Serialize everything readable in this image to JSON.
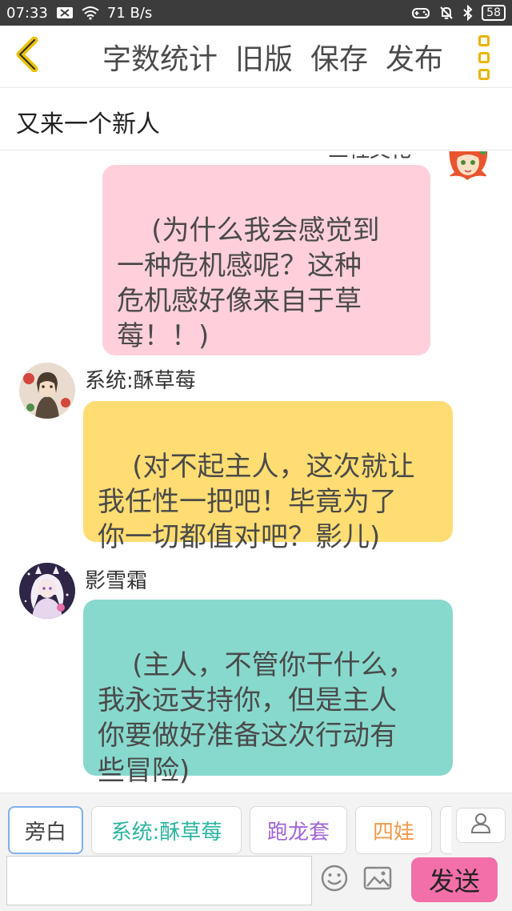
{
  "status_bar": {
    "time": "07:33",
    "network_speed": "71 B/s",
    "battery": "58"
  },
  "toolbar": {
    "word_count_label": "字数统计",
    "old_version_label": "旧版",
    "save_label": "保存",
    "publish_label": "发布"
  },
  "title": "又来一个新人",
  "messages": [
    {
      "sender_partial": "三枉文化",
      "text": "(为什么我会感觉到\n一种危机感呢？这种\n危机感好像来自于草\n莓！！)",
      "color": "#ffd0dc"
    },
    {
      "sender": "系统:酥草莓",
      "text": "(对不起主人，这次就让\n我任性一把吧！毕竟为了\n你一切都值对吧？影儿)",
      "color": "#ffdd72"
    },
    {
      "sender": "影雪霜",
      "text": "(主人，不管你干什么，\n我永远支持你，但是主人\n你要做好准备这次行动有\n些冒险)",
      "color": "#88d9cd"
    }
  ],
  "role_chips": [
    {
      "label": "旁白",
      "color": "#444444"
    },
    {
      "label": "系统:酥草莓",
      "color": "#2bb5a0"
    },
    {
      "label": "跑龙套",
      "color": "#a064d4"
    },
    {
      "label": "四娃",
      "color": "#f09a4c"
    }
  ],
  "input": {
    "value": "",
    "placeholder": ""
  },
  "send_label": "发送"
}
